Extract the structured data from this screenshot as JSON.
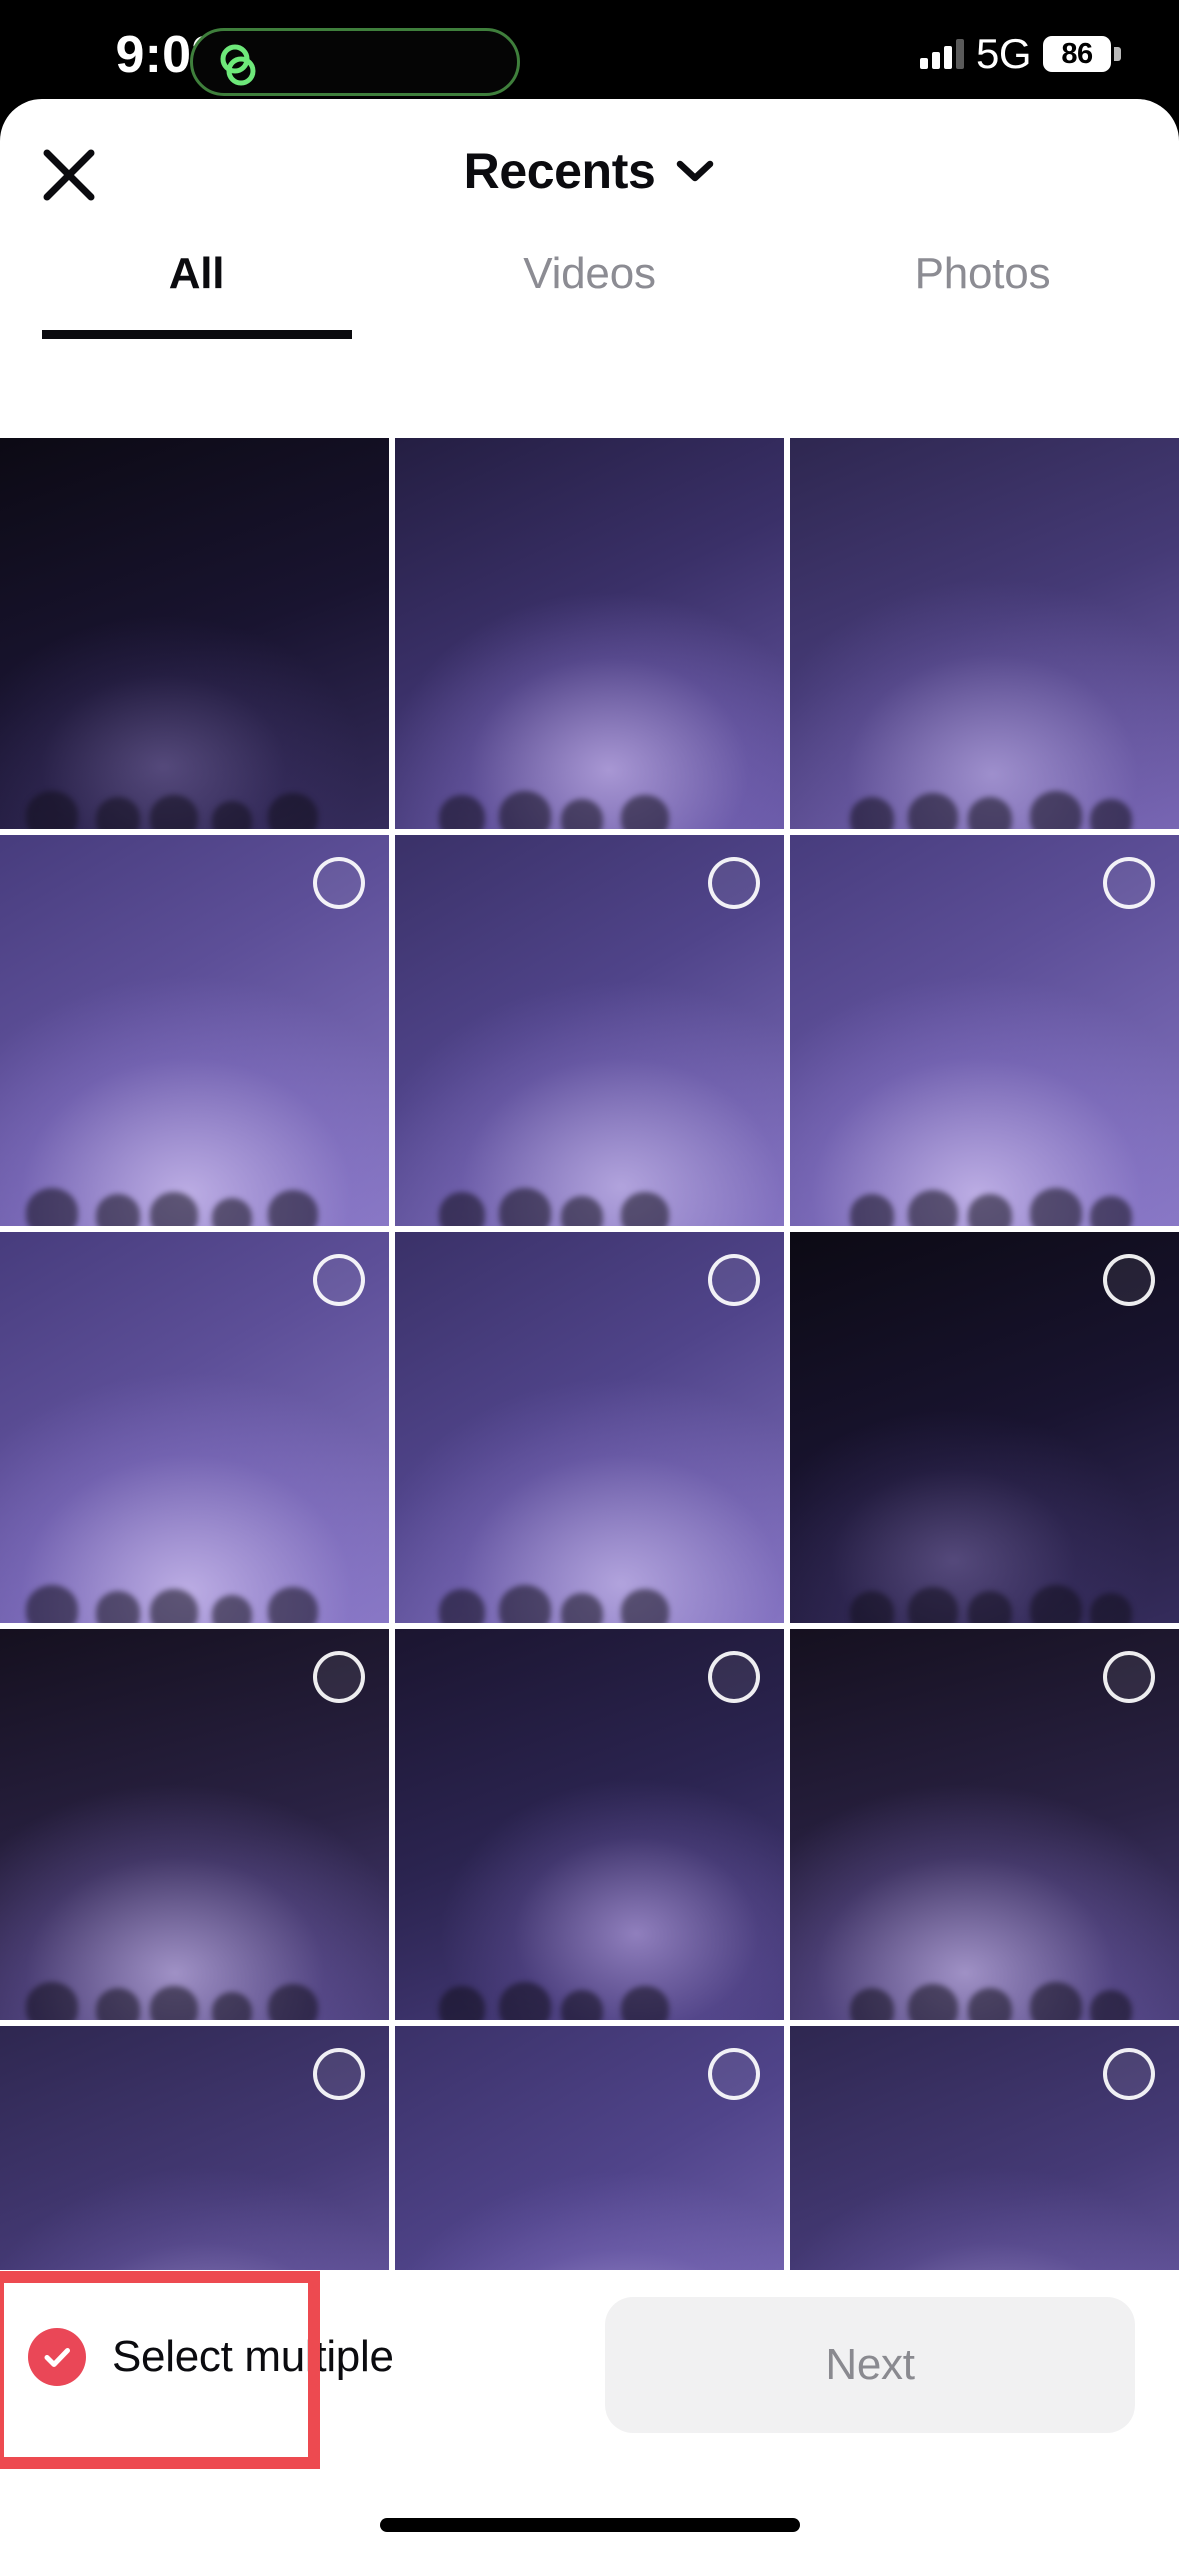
{
  "status_bar": {
    "time": "9:02",
    "network": "5G",
    "battery_level": "86",
    "dynamic_island_icon": "link-loop-icon",
    "signal_icon": "cellular-signal-icon"
  },
  "header": {
    "close_icon": "close-x-icon",
    "album_title": "Recents",
    "chevron_icon": "chevron-down-icon"
  },
  "tabs": [
    {
      "label": "All",
      "active": true
    },
    {
      "label": "Videos",
      "active": false
    },
    {
      "label": "Photos",
      "active": false
    }
  ],
  "grid": {
    "columns": 3,
    "rows": 5,
    "tiles": [
      {
        "id": 1,
        "variant": "ph-dark",
        "selected": false,
        "circle_visible": false
      },
      {
        "id": 2,
        "variant": "ph-b",
        "selected": false,
        "circle_visible": false
      },
      {
        "id": 3,
        "variant": "ph-e",
        "selected": false,
        "circle_visible": false
      },
      {
        "id": 4,
        "variant": "ph-c",
        "selected": false,
        "circle_visible": true
      },
      {
        "id": 5,
        "variant": "ph-f",
        "selected": false,
        "circle_visible": true
      },
      {
        "id": 6,
        "variant": "ph-c",
        "selected": false,
        "circle_visible": true
      },
      {
        "id": 7,
        "variant": "ph-c",
        "selected": false,
        "circle_visible": true
      },
      {
        "id": 8,
        "variant": "ph-f",
        "selected": false,
        "circle_visible": true
      },
      {
        "id": 9,
        "variant": "ph-dark",
        "selected": false,
        "circle_visible": true
      },
      {
        "id": 10,
        "variant": "ph-d",
        "selected": false,
        "circle_visible": true
      },
      {
        "id": 11,
        "variant": "ph-a",
        "selected": false,
        "circle_visible": true
      },
      {
        "id": 12,
        "variant": "ph-d",
        "selected": false,
        "circle_visible": true
      },
      {
        "id": 13,
        "variant": "ph-e",
        "selected": false,
        "circle_visible": true
      },
      {
        "id": 14,
        "variant": "ph-f",
        "selected": false,
        "circle_visible": true
      },
      {
        "id": 15,
        "variant": "ph-e",
        "selected": false,
        "circle_visible": true
      }
    ]
  },
  "bottom_bar": {
    "select_multiple_label": "Select multiple",
    "select_multiple_icon": "check-circle-icon",
    "select_multiple_enabled": true,
    "next_label": "Next",
    "next_enabled": false
  },
  "annotation": {
    "target": "select-multiple",
    "color": "#ED4A50"
  },
  "colors": {
    "accent_check": "#EA4757",
    "annotation_red": "#ED4A50",
    "next_button_bg": "#F1F1F2",
    "next_button_text": "#8A8A90",
    "tab_active": "#0B0B0F",
    "tab_inactive": "#8C8C93",
    "island_green": "#6EE87A"
  }
}
